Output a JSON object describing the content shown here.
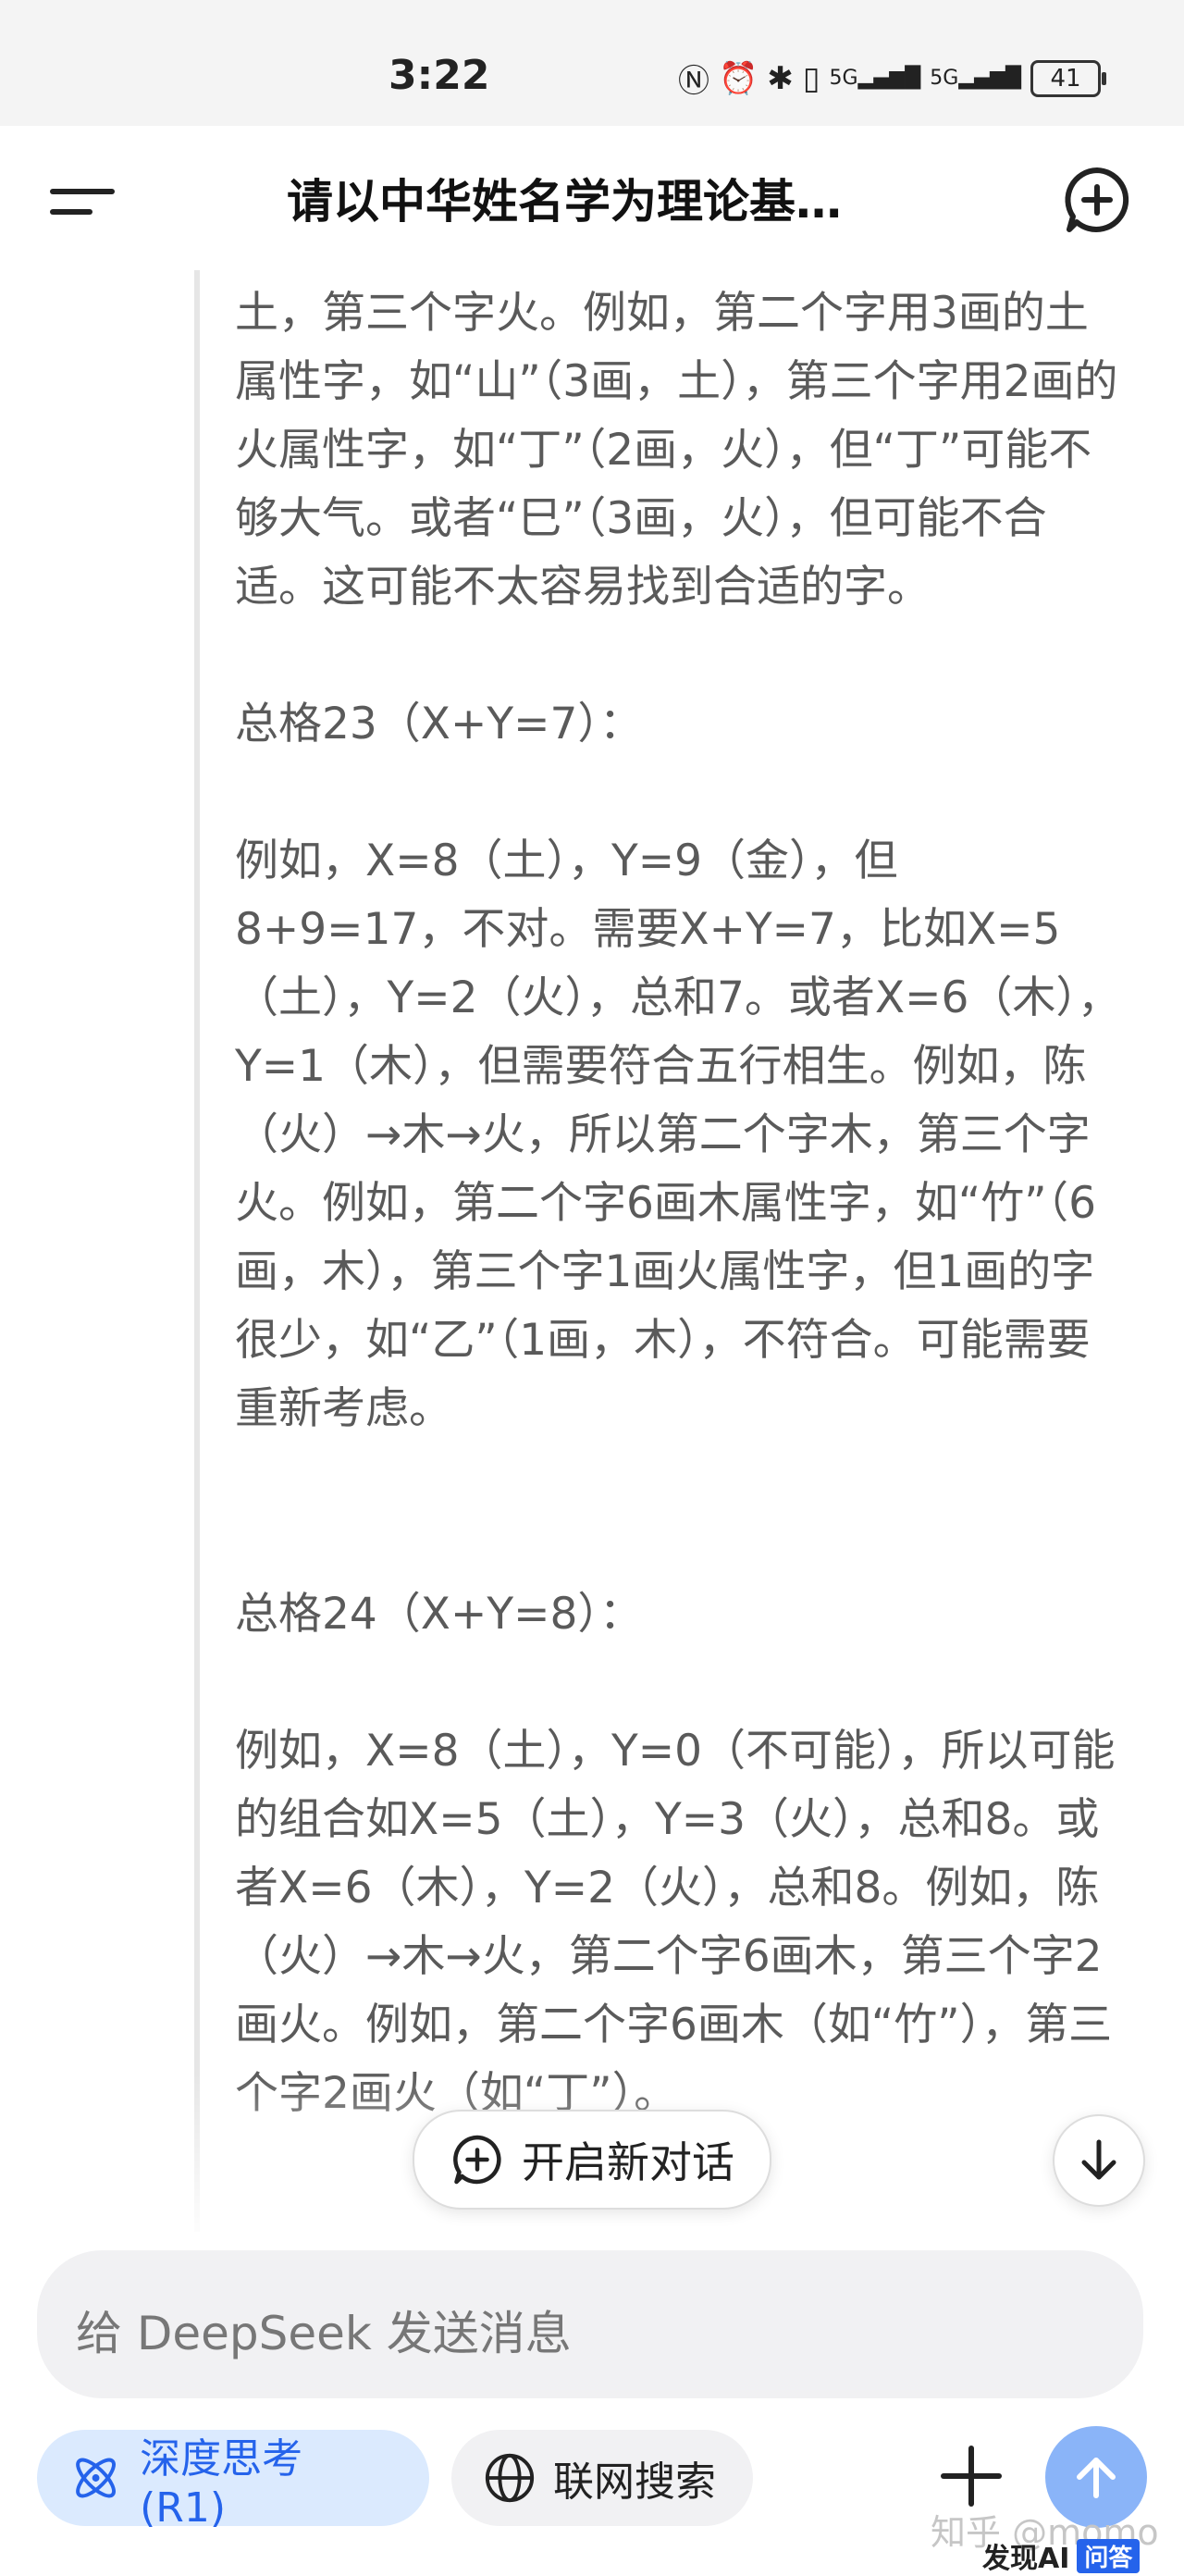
{
  "status_bar": {
    "time": "3:22",
    "network_1": "5G",
    "network_2": "5G",
    "battery": "41"
  },
  "header": {
    "title": "请以中华姓名学为理论基…"
  },
  "content": {
    "paragraphs": [
      "土，第三个字火。例如，第二个字用3画的土属性字，如“山”（3画，土），第三个字用2画的火属性字，如“丁”（2画，火），但“丁”可能不够大气。或者“巳”（3画，火），但可能不合适。这可能不太容易找到合适的字。",
      "总格23（X+Y=7）：",
      "例如，X=8（土），Y=9（金），但8+9=17，不对。需要X+Y=7，比如X=5（土），Y=2（火），总和7。或者X=6（木），Y=1（木），但需要符合五行相生。例如，陈（火）→木→火，所以第二个字木，第三个字火。例如，第二个字6画木属性字，如“竹”（6画，木），第三个字1画火属性字，但1画的字很少，如“乙”（1画，木），不符合。可能需要重新考虑。",
      "总格24（X+Y=8）：",
      "例如，X=8（土），Y=0（不可能），所以可能的组合如X=5（土），Y=3（火），总和8。或者X=6（木），Y=2（火），总和8。例如，陈（火）→木→火，第二个字6画木，第三个字2画火。例如，第二个字6画木（如“竹”），第三个字2画火（如“丁”）。"
    ]
  },
  "floating": {
    "new_dialog_label": "开启新对话"
  },
  "composer": {
    "placeholder": "给 DeepSeek 发送消息",
    "deep_think_label": "深度思考 (R1)",
    "web_search_label": "联网搜索"
  },
  "watermark": {
    "text": "知乎 @momo",
    "brand_text": "发现AI",
    "brand_badge": "问答"
  },
  "colors": {
    "accent_blue": "#2563eb",
    "deep_pill_bg": "#dbeafe",
    "send_button": "#8ab4f8",
    "thought_text": "#5a5a5a"
  }
}
